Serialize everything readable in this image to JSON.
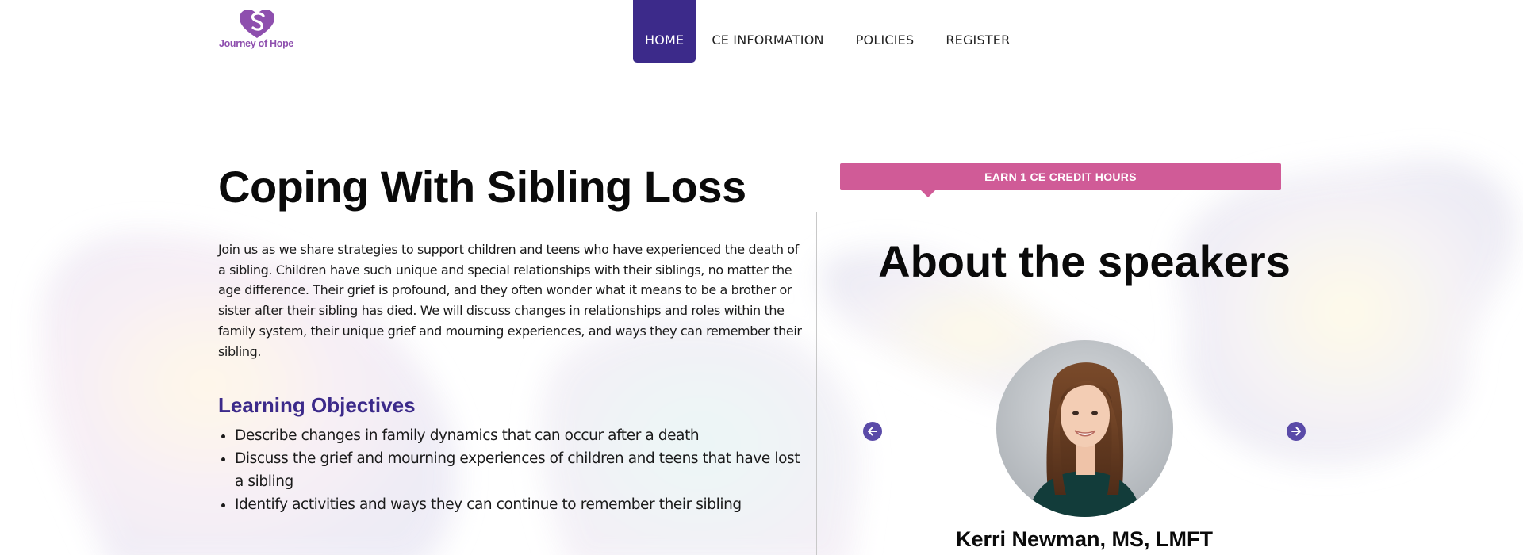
{
  "header": {
    "logo_text": "Journey of Hope",
    "nav": [
      {
        "label": "HOME",
        "active": true
      },
      {
        "label": "CE INFORMATION",
        "active": false
      },
      {
        "label": "POLICIES",
        "active": false
      },
      {
        "label": "REGISTER",
        "active": false
      }
    ]
  },
  "main": {
    "title": "Coping With Sibling Loss",
    "intro": "Join us as we share strategies to support children and teens who have experienced the death of a sibling. Children have such unique and special relationships with their siblings, no matter the age difference. Their grief is profound, and they often wonder what it means to be a brother or sister after their sibling has died. We will discuss changes in relationships and roles within the family system, their unique grief and mourning experiences, and ways they can remember their sibling.",
    "objectives_title": "Learning Objectives",
    "objectives": [
      "Describe changes in family dynamics that can occur after a death",
      "Discuss the grief and mourning experiences of children and teens that have lost a sibling",
      "Identify activities and ways they can continue to remember their sibling"
    ]
  },
  "aside": {
    "ce_banner": "EARN 1 CE CREDIT HOURS",
    "speakers_title": "About the speakers",
    "speaker_name": "Kerri Newman, MS, LMFT",
    "prev_icon": "arrow-left-icon",
    "next_icon": "arrow-right-icon"
  },
  "colors": {
    "brand_purple": "#3c2a8a",
    "logo_purple": "#8e4fae",
    "banner_pink": "#d05b97",
    "arrow_purple": "#5a4aa8"
  }
}
